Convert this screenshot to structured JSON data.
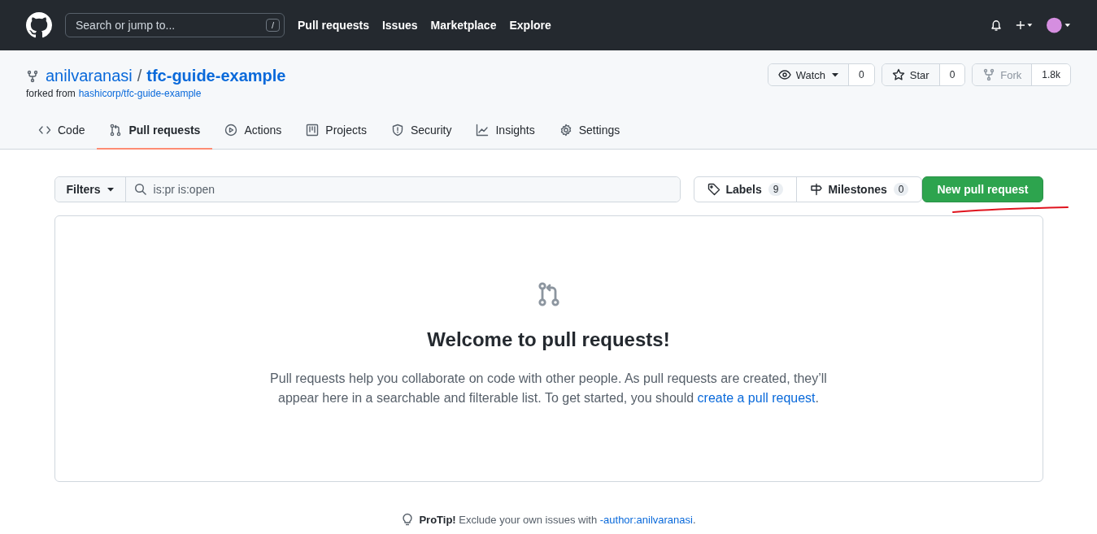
{
  "header": {
    "search": {
      "placeholder": "Search or jump to...",
      "key": "/"
    },
    "nav": [
      "Pull requests",
      "Issues",
      "Marketplace",
      "Explore"
    ]
  },
  "repo": {
    "owner": "anilvaranasi",
    "separator": "/",
    "name": "tfc-guide-example",
    "forked_label": "forked from",
    "fork_source": "hashicorp/tfc-guide-example",
    "actions": [
      {
        "kind": "watch",
        "label": "Watch",
        "count": "0",
        "disabled": false
      },
      {
        "kind": "star",
        "label": "Star",
        "count": "0",
        "disabled": false
      },
      {
        "kind": "fork",
        "label": "Fork",
        "count": "1.8k",
        "disabled": true
      }
    ]
  },
  "tabs": [
    {
      "kind": "code",
      "label": "Code",
      "selected": false
    },
    {
      "kind": "pulls",
      "label": "Pull requests",
      "selected": true
    },
    {
      "kind": "actions",
      "label": "Actions",
      "selected": false
    },
    {
      "kind": "projects",
      "label": "Projects",
      "selected": false
    },
    {
      "kind": "security",
      "label": "Security",
      "selected": false
    },
    {
      "kind": "insights",
      "label": "Insights",
      "selected": false
    },
    {
      "kind": "settings",
      "label": "Settings",
      "selected": false
    }
  ],
  "toolbar": {
    "filters": "Filters",
    "query": "is:pr is:open",
    "links": [
      {
        "kind": "label",
        "label": "Labels",
        "count": "9"
      },
      {
        "kind": "milestone",
        "label": "Milestones",
        "count": "0"
      }
    ],
    "new_button": "New pull request"
  },
  "blankslate": {
    "title": "Welcome to pull requests!",
    "text": "Pull requests help you collaborate on code with other people. As pull requests are created, they’ll appear here in a searchable and filterable list. To get started, you should ",
    "link": "create a pull request",
    "after": "."
  },
  "protip": {
    "label": "ProTip!",
    "text": "Exclude your own issues with ",
    "link": "-author:anilvaranasi",
    "after": "."
  }
}
